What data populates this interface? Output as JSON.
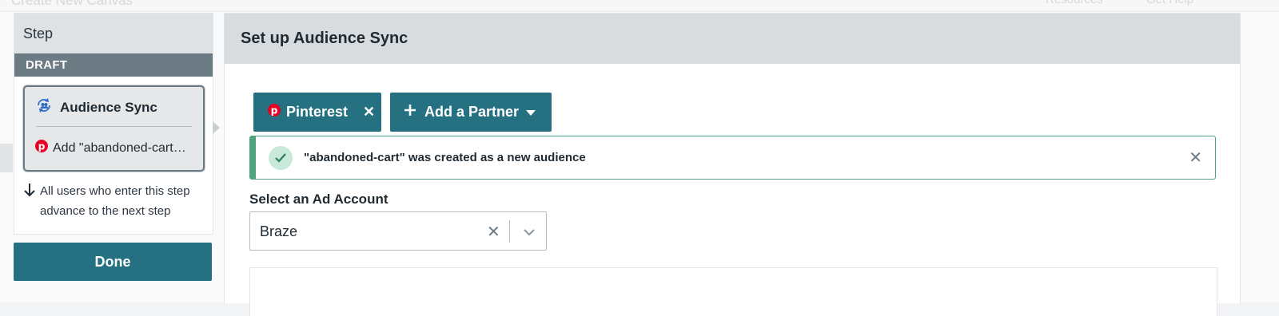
{
  "background": {
    "page_title": "Create New Canvas",
    "links": [
      "Resources",
      "Get Help"
    ]
  },
  "step_panel": {
    "header": "Step",
    "status_badge": "DRAFT",
    "card": {
      "title": "Audience Sync",
      "icon": "audience-sync-icon",
      "action": "Add \"abandoned-cart\" audience",
      "action_icon": "pinterest-icon"
    },
    "advance_text": "All users who enter this step advance to the next step",
    "done_label": "Done"
  },
  "main": {
    "title": "Set up Audience Sync",
    "partner_chip": {
      "label": "Pinterest",
      "icon": "pinterest-icon"
    },
    "add_partner_label": "Add a Partner",
    "alert": {
      "message": "\"abandoned-cart\" was created as a new audience",
      "status": "success"
    },
    "ad_account": {
      "label": "Select an Ad Account",
      "value": "Braze"
    }
  },
  "colors": {
    "accent": "#257182",
    "draft": "#6c7a83",
    "success": "#4fa47d",
    "pinterest": "#e60023"
  }
}
